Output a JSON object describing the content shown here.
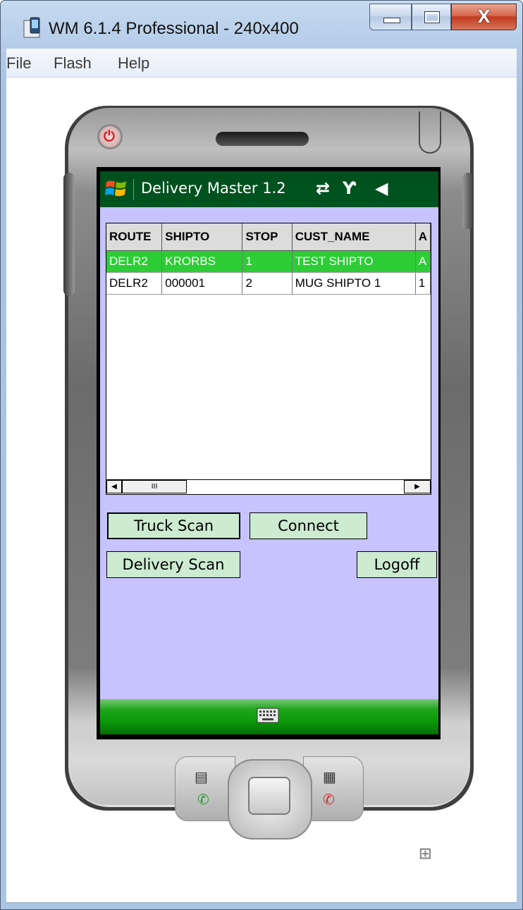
{
  "window": {
    "title": "WM 6.1.4 Professional - 240x400",
    "controls": {
      "minimize": "minimize",
      "maximize": "maximize",
      "close": "X"
    }
  },
  "menu": {
    "items": [
      "File",
      "Flash",
      "Help"
    ]
  },
  "device_screen": {
    "taskbar": {
      "app_title": "Delivery Master 1.2",
      "icons": [
        "start-icon",
        "sync-icon",
        "signal-off-icon",
        "volume-icon"
      ]
    },
    "grid": {
      "columns": [
        "ROUTE",
        "SHIPTO",
        "STOP",
        "CUST_NAME",
        "A"
      ],
      "rows": [
        {
          "route": "DELR2",
          "shipto": "KRORBS",
          "stop": "1",
          "cust_name": "TEST SHIPTO",
          "extra": "A",
          "selected": true
        },
        {
          "route": "DELR2",
          "shipto": "000001",
          "stop": "2",
          "cust_name": "MUG SHIPTO 1",
          "extra": "1",
          "selected": false
        }
      ],
      "scrollbar_thumb_label": "III"
    },
    "buttons": {
      "truck_scan": "Truck Scan",
      "connect": "Connect",
      "delivery_scan": "Delivery Scan",
      "logoff": "Logoff"
    },
    "softkey": {
      "keyboard_icon": "keyboard-icon"
    },
    "colors": {
      "taskbar_bg": "#00541f",
      "form_bg": "#c6c3ff",
      "selected_row": "#2ccd35",
      "button_bg": "#ccebd0",
      "softbar": "#0c9b0a"
    }
  }
}
